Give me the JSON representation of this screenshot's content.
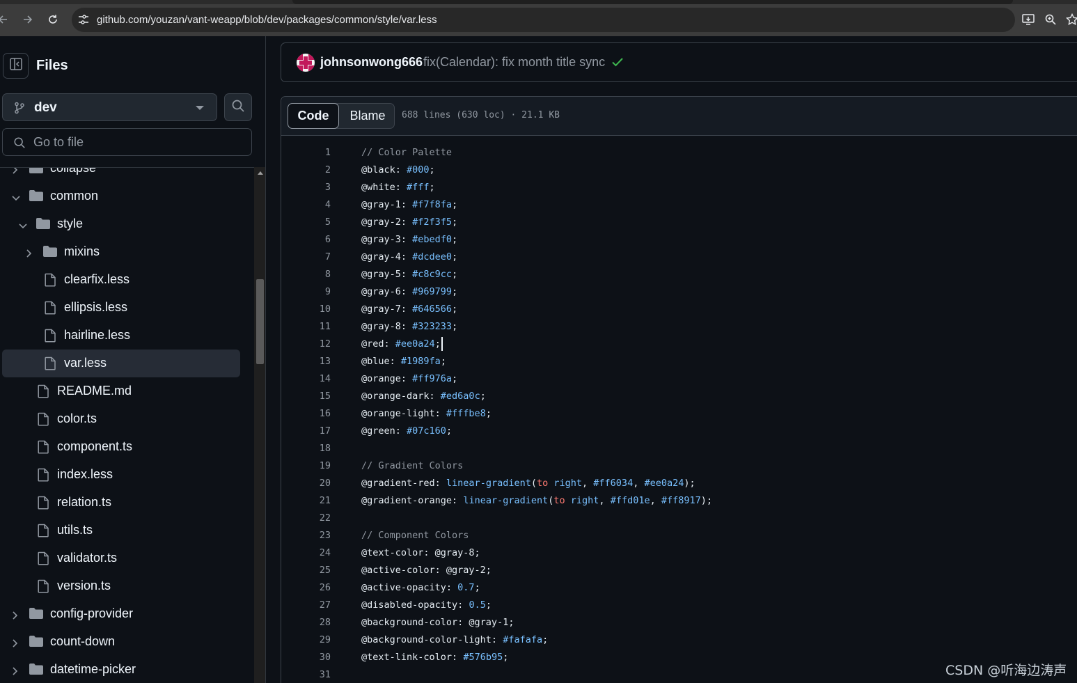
{
  "browser": {
    "url": "github.com/youzan/vant-weapp/blob/dev/packages/common/style/var.less"
  },
  "sidebar": {
    "title": "Files",
    "branch": "dev",
    "goto_placeholder": "Go to file",
    "tree": [
      {
        "label": "collapse",
        "type": "folder",
        "expanded": false,
        "depth": 0
      },
      {
        "label": "common",
        "type": "folder",
        "expanded": true,
        "depth": 0
      },
      {
        "label": "style",
        "type": "folder",
        "expanded": true,
        "depth": 1
      },
      {
        "label": "mixins",
        "type": "folder",
        "expanded": false,
        "depth": 2
      },
      {
        "label": "clearfix.less",
        "type": "file",
        "depth": 2
      },
      {
        "label": "ellipsis.less",
        "type": "file",
        "depth": 2
      },
      {
        "label": "hairline.less",
        "type": "file",
        "depth": 2
      },
      {
        "label": "var.less",
        "type": "file",
        "depth": 2,
        "selected": true
      },
      {
        "label": "README.md",
        "type": "file",
        "depth": 1
      },
      {
        "label": "color.ts",
        "type": "file",
        "depth": 1
      },
      {
        "label": "component.ts",
        "type": "file",
        "depth": 1
      },
      {
        "label": "index.less",
        "type": "file",
        "depth": 1
      },
      {
        "label": "relation.ts",
        "type": "file",
        "depth": 1
      },
      {
        "label": "utils.ts",
        "type": "file",
        "depth": 1
      },
      {
        "label": "validator.ts",
        "type": "file",
        "depth": 1
      },
      {
        "label": "version.ts",
        "type": "file",
        "depth": 1
      },
      {
        "label": "config-provider",
        "type": "folder",
        "expanded": false,
        "depth": 0
      },
      {
        "label": "count-down",
        "type": "folder",
        "expanded": false,
        "depth": 0
      },
      {
        "label": "datetime-picker",
        "type": "folder",
        "expanded": false,
        "depth": 0
      }
    ]
  },
  "commit": {
    "author": "johnsonwong666",
    "message": "fix(Calendar): fix month title sync"
  },
  "viewer": {
    "code_tab": "Code",
    "blame_tab": "Blame",
    "file_info": "688 lines (630 loc) · 21.1 KB",
    "cursor_line": 12,
    "lines": [
      {
        "n": "1",
        "tokens": [
          [
            "cmt",
            "// Color Palette"
          ]
        ]
      },
      {
        "n": "2",
        "tokens": [
          [
            "txt",
            "@black: "
          ],
          [
            "val",
            "#000"
          ],
          [
            "txt",
            ";"
          ]
        ]
      },
      {
        "n": "3",
        "tokens": [
          [
            "txt",
            "@white: "
          ],
          [
            "val",
            "#fff"
          ],
          [
            "txt",
            ";"
          ]
        ]
      },
      {
        "n": "4",
        "tokens": [
          [
            "txt",
            "@gray-1: "
          ],
          [
            "val",
            "#f7f8fa"
          ],
          [
            "txt",
            ";"
          ]
        ]
      },
      {
        "n": "5",
        "tokens": [
          [
            "txt",
            "@gray-2: "
          ],
          [
            "val",
            "#f2f3f5"
          ],
          [
            "txt",
            ";"
          ]
        ]
      },
      {
        "n": "6",
        "tokens": [
          [
            "txt",
            "@gray-3: "
          ],
          [
            "val",
            "#ebedf0"
          ],
          [
            "txt",
            ";"
          ]
        ]
      },
      {
        "n": "7",
        "tokens": [
          [
            "txt",
            "@gray-4: "
          ],
          [
            "val",
            "#dcdee0"
          ],
          [
            "txt",
            ";"
          ]
        ]
      },
      {
        "n": "8",
        "tokens": [
          [
            "txt",
            "@gray-5: "
          ],
          [
            "val",
            "#c8c9cc"
          ],
          [
            "txt",
            ";"
          ]
        ]
      },
      {
        "n": "9",
        "tokens": [
          [
            "txt",
            "@gray-6: "
          ],
          [
            "val",
            "#969799"
          ],
          [
            "txt",
            ";"
          ]
        ]
      },
      {
        "n": "10",
        "tokens": [
          [
            "txt",
            "@gray-7: "
          ],
          [
            "val",
            "#646566"
          ],
          [
            "txt",
            ";"
          ]
        ]
      },
      {
        "n": "11",
        "tokens": [
          [
            "txt",
            "@gray-8: "
          ],
          [
            "val",
            "#323233"
          ],
          [
            "txt",
            ";"
          ]
        ]
      },
      {
        "n": "12",
        "tokens": [
          [
            "txt",
            "@red: "
          ],
          [
            "val",
            "#ee0a24"
          ],
          [
            "txt",
            ";"
          ]
        ]
      },
      {
        "n": "13",
        "tokens": [
          [
            "txt",
            "@blue: "
          ],
          [
            "val",
            "#1989fa"
          ],
          [
            "txt",
            ";"
          ]
        ]
      },
      {
        "n": "14",
        "tokens": [
          [
            "txt",
            "@orange: "
          ],
          [
            "val",
            "#ff976a"
          ],
          [
            "txt",
            ";"
          ]
        ]
      },
      {
        "n": "15",
        "tokens": [
          [
            "txt",
            "@orange-dark: "
          ],
          [
            "val",
            "#ed6a0c"
          ],
          [
            "txt",
            ";"
          ]
        ]
      },
      {
        "n": "16",
        "tokens": [
          [
            "txt",
            "@orange-light: "
          ],
          [
            "val",
            "#fffbe8"
          ],
          [
            "txt",
            ";"
          ]
        ]
      },
      {
        "n": "17",
        "tokens": [
          [
            "txt",
            "@green: "
          ],
          [
            "val",
            "#07c160"
          ],
          [
            "txt",
            ";"
          ]
        ]
      },
      {
        "n": "18",
        "tokens": []
      },
      {
        "n": "19",
        "tokens": [
          [
            "cmt",
            "// Gradient Colors"
          ]
        ]
      },
      {
        "n": "20",
        "tokens": [
          [
            "txt",
            "@gradient-red: "
          ],
          [
            "fn",
            "linear-gradient"
          ],
          [
            "txt",
            "("
          ],
          [
            "kw",
            "to"
          ],
          [
            "txt",
            " "
          ],
          [
            "val",
            "right"
          ],
          [
            "txt",
            ", "
          ],
          [
            "val",
            "#ff6034"
          ],
          [
            "txt",
            ", "
          ],
          [
            "val",
            "#ee0a24"
          ],
          [
            "txt",
            ");"
          ]
        ]
      },
      {
        "n": "21",
        "tokens": [
          [
            "txt",
            "@gradient-orange: "
          ],
          [
            "fn",
            "linear-gradient"
          ],
          [
            "txt",
            "("
          ],
          [
            "kw",
            "to"
          ],
          [
            "txt",
            " "
          ],
          [
            "val",
            "right"
          ],
          [
            "txt",
            ", "
          ],
          [
            "val",
            "#ffd01e"
          ],
          [
            "txt",
            ", "
          ],
          [
            "val",
            "#ff8917"
          ],
          [
            "txt",
            ");"
          ]
        ]
      },
      {
        "n": "22",
        "tokens": []
      },
      {
        "n": "23",
        "tokens": [
          [
            "cmt",
            "// Component Colors"
          ]
        ]
      },
      {
        "n": "24",
        "tokens": [
          [
            "txt",
            "@text-color: @gray-8;"
          ]
        ]
      },
      {
        "n": "25",
        "tokens": [
          [
            "txt",
            "@active-color: @gray-2;"
          ]
        ]
      },
      {
        "n": "26",
        "tokens": [
          [
            "txt",
            "@active-opacity: "
          ],
          [
            "val",
            "0.7"
          ],
          [
            "txt",
            ";"
          ]
        ]
      },
      {
        "n": "27",
        "tokens": [
          [
            "txt",
            "@disabled-opacity: "
          ],
          [
            "val",
            "0.5"
          ],
          [
            "txt",
            ";"
          ]
        ]
      },
      {
        "n": "28",
        "tokens": [
          [
            "txt",
            "@background-color: @gray-1;"
          ]
        ]
      },
      {
        "n": "29",
        "tokens": [
          [
            "txt",
            "@background-color-light: "
          ],
          [
            "val",
            "#fafafa"
          ],
          [
            "txt",
            ";"
          ]
        ]
      },
      {
        "n": "30",
        "tokens": [
          [
            "txt",
            "@text-link-color: "
          ],
          [
            "val",
            "#576b95"
          ],
          [
            "txt",
            ";"
          ]
        ]
      },
      {
        "n": "31",
        "tokens": []
      }
    ]
  },
  "watermark": "CSDN @听海边涛声",
  "colors": {
    "background": "#0d1117",
    "border": "#3d444d",
    "syntax_value": "#79c0ff",
    "syntax_keyword": "#ff7b72",
    "comment": "#9198a1",
    "check": "#3fb950"
  },
  "icons": {
    "back": "arrow-left-icon",
    "forward": "arrow-right-icon",
    "reload": "reload-icon",
    "site_info": "tune-icon",
    "install": "install-app-icon",
    "zoom": "zoom-icon",
    "bookmark": "star-icon",
    "sidebar_toggle": "sidebar-collapse-icon",
    "branch": "git-branch-icon",
    "search": "search-icon",
    "folder": "folder-icon",
    "file": "file-icon",
    "status": "check-icon"
  }
}
